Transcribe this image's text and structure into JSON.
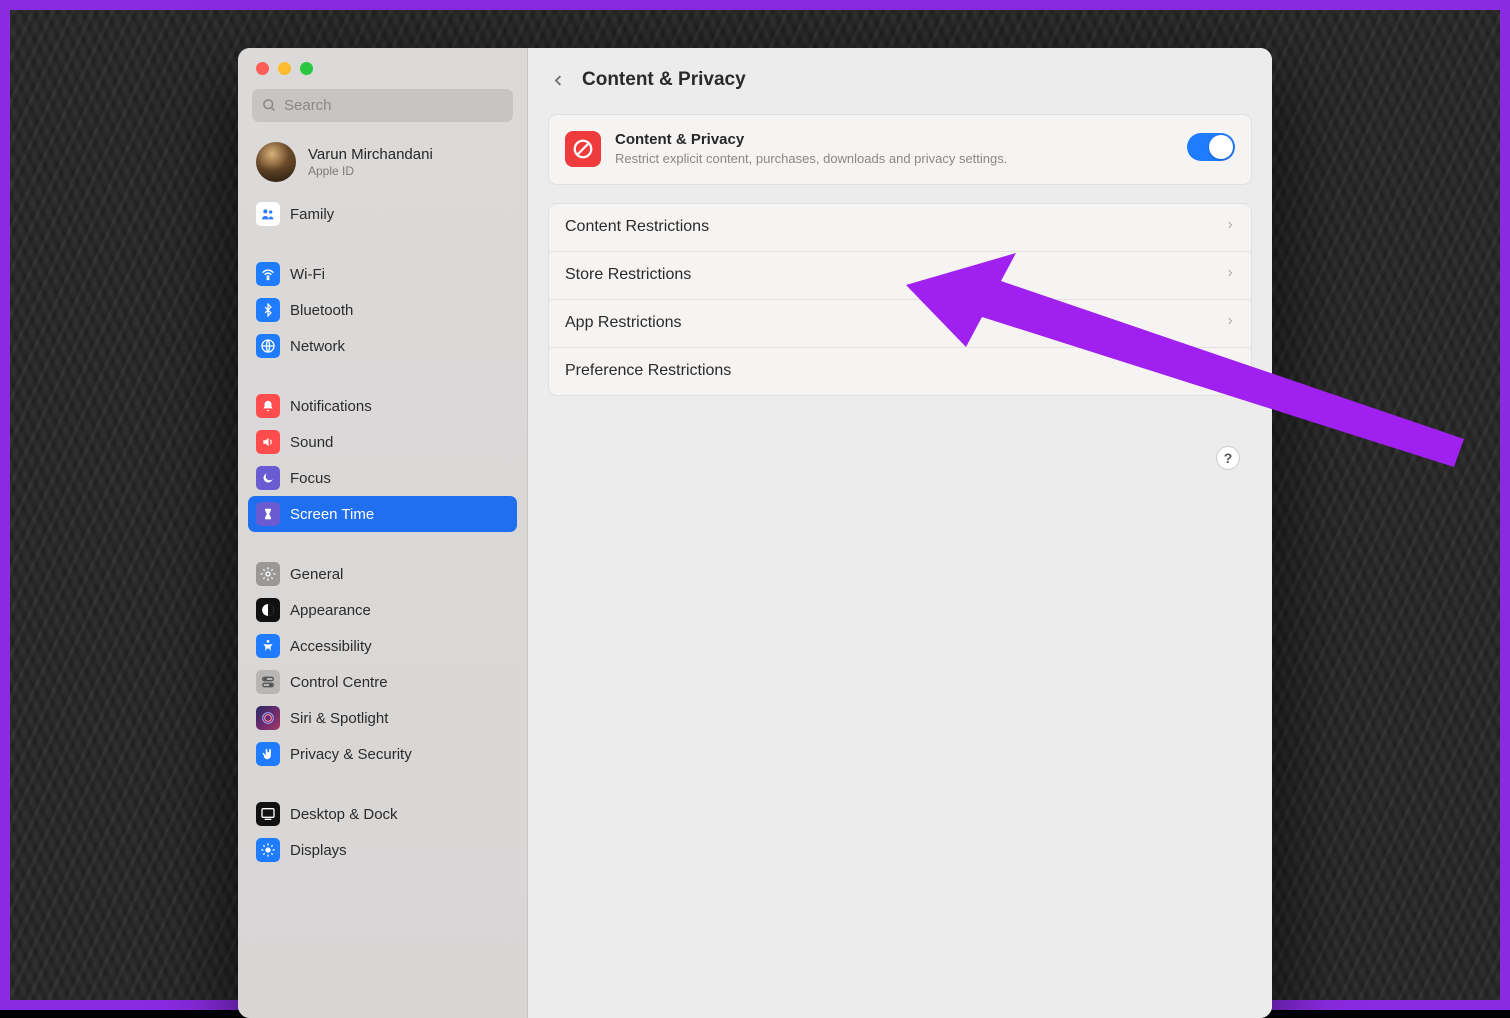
{
  "search": {
    "placeholder": "Search"
  },
  "user": {
    "name": "Varun Mirchandani",
    "sub": "Apple ID"
  },
  "sidebar": {
    "family": "Family",
    "wifi": "Wi-Fi",
    "bluetooth": "Bluetooth",
    "network": "Network",
    "notifications": "Notifications",
    "sound": "Sound",
    "focus": "Focus",
    "screentime": "Screen Time",
    "general": "General",
    "appearance": "Appearance",
    "accessibility": "Accessibility",
    "controlcentre": "Control Centre",
    "siri": "Siri & Spotlight",
    "privacy": "Privacy & Security",
    "desktop": "Desktop & Dock",
    "displays": "Displays"
  },
  "header": {
    "title": "Content & Privacy"
  },
  "contentPrivacy": {
    "title": "Content & Privacy",
    "desc": "Restrict explicit content, purchases, downloads and privacy settings.",
    "toggle": true
  },
  "restrictions": {
    "content": "Content Restrictions",
    "store": "Store Restrictions",
    "app": "App Restrictions",
    "preference": "Preference Restrictions"
  },
  "help": "?"
}
